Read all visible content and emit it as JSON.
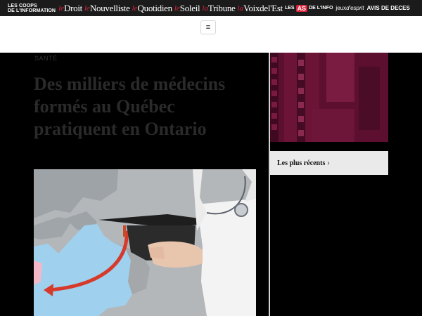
{
  "topbar": {
    "coops_line1": "LES COOPS",
    "coops_line2": "DE L'INFORMATION",
    "papers": [
      {
        "prefix": "le",
        "name": "Droit"
      },
      {
        "prefix": "le",
        "name": "Nouvelliste"
      },
      {
        "prefix": "le",
        "name": "Quotidien"
      },
      {
        "prefix": "le",
        "name": "Soleil"
      },
      {
        "prefix": "la",
        "name": "Tribune"
      },
      {
        "prefix": "la",
        "name": "Voixdel'Est"
      }
    ],
    "as_prefix": "LES",
    "as_badge": "AS",
    "as_suffix": "DE L'INFO",
    "jeux": "jeux",
    "jeux_suffix": "d'esprit",
    "avis": "AVIS DE DECES"
  },
  "header": {
    "menu_icon": "hamburger-icon",
    "menu_glyph": "≡"
  },
  "article": {
    "category": "SANTÉ",
    "headline": "Des milliers de médecins formés au Québec pratiquent en Ontario"
  },
  "sidebar": {
    "recent_label": "Les plus récents",
    "recent_chevron": "›"
  },
  "colors": {
    "brand_red": "#d9233a",
    "topbar_bg": "#1b1b1b",
    "ad_bg": "#5b0f2c"
  }
}
